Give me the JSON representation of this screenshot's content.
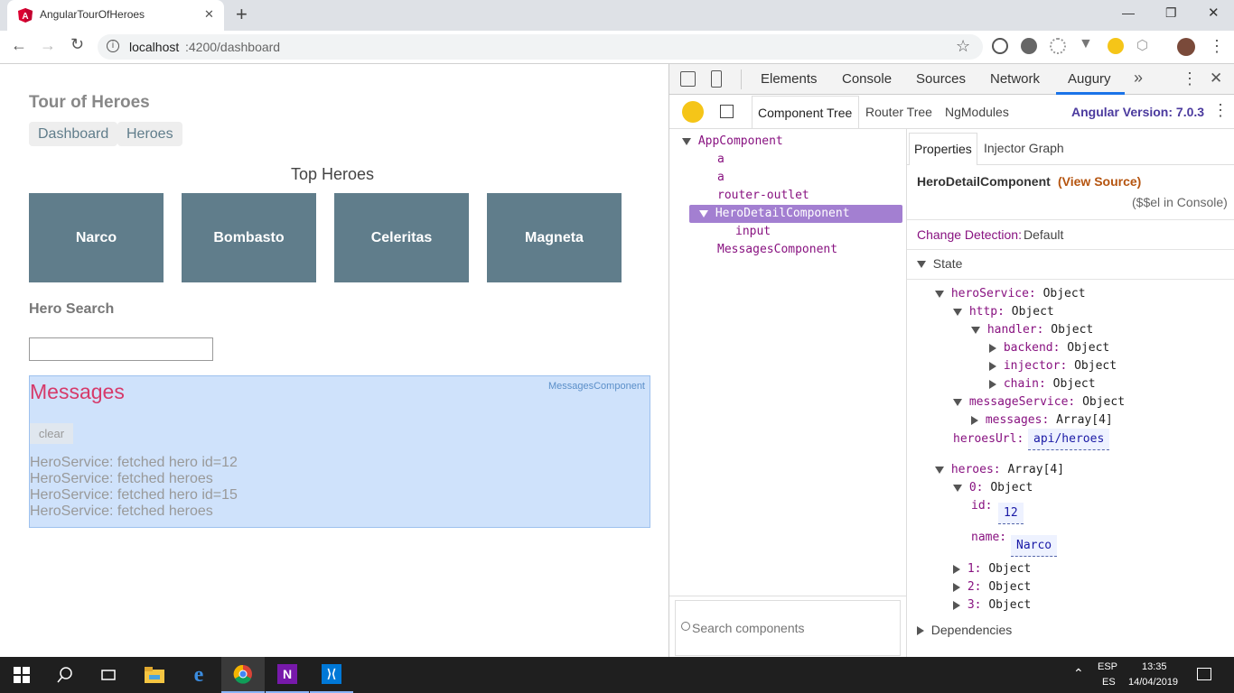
{
  "browser": {
    "tab_title": "AngularTourOfHeroes",
    "new_tab": "+",
    "url_host": "localhost",
    "url_rest": ":4200/dashboard",
    "window_controls": {
      "minimize": "—",
      "maximize": "❐",
      "close": "✕"
    }
  },
  "app": {
    "title": "Tour of Heroes",
    "nav": [
      {
        "label": "Dashboard"
      },
      {
        "label": "Heroes"
      }
    ],
    "top_heroes_title": "Top Heroes",
    "heroes": [
      {
        "name": "Narco"
      },
      {
        "name": "Bombasto"
      },
      {
        "name": "Celeritas"
      },
      {
        "name": "Magneta"
      }
    ],
    "search_title": "Hero Search",
    "search_value": "",
    "messages": {
      "tag": "MessagesComponent",
      "title": "Messages",
      "clear_label": "clear",
      "lines": [
        "HeroService: fetched hero id=12",
        "HeroService: fetched heroes",
        "HeroService: fetched hero id=15",
        "HeroService: fetched heroes"
      ]
    }
  },
  "devtools": {
    "tabs": [
      "Elements",
      "Console",
      "Sources",
      "Network",
      "Augury"
    ],
    "more": "»",
    "augury_tabs": [
      "Component Tree",
      "Router Tree",
      "NgModules"
    ],
    "angular_version": "Angular Version: 7.0.3",
    "tree": [
      {
        "label": "AppComponent"
      },
      {
        "label": "a"
      },
      {
        "label": "a"
      },
      {
        "label": "router-outlet"
      },
      {
        "label": "HeroDetailComponent"
      },
      {
        "label": "input"
      },
      {
        "label": "MessagesComponent"
      }
    ],
    "search_placeholder": "Search components",
    "prop_tabs": [
      "Properties",
      "Injector Graph"
    ],
    "component_name": "HeroDetailComponent",
    "view_source": "(View Source)",
    "el_console": "($$el in Console)",
    "change_detection_label": "Change Detection:",
    "change_detection_value": "Default",
    "state_label": "State",
    "dependencies_label": "Dependencies",
    "state": {
      "heroService": "heroService:",
      "heroService_val": "Object",
      "http": "http:",
      "http_val": "Object",
      "handler": "handler:",
      "handler_val": "Object",
      "backend": "backend:",
      "backend_val": "Object",
      "injector": "injector:",
      "injector_val": "Object",
      "chain": "chain:",
      "chain_val": "Object",
      "messageService": "messageService:",
      "messageService_val": "Object",
      "messages": "messages:",
      "messages_val": "Array[4]",
      "heroesUrl": "heroesUrl:",
      "heroesUrl_val": "api/heroes",
      "heroes": "heroes:",
      "heroes_val": "Array[4]",
      "h0": "0:",
      "h0_val": "Object",
      "id": "id:",
      "id_val": "12",
      "name": "name:",
      "name_val": "Narco",
      "h1": "1:",
      "h1_val": "Object",
      "h2": "2:",
      "h2_val": "Object",
      "h3": "3:",
      "h3_val": "Object"
    }
  },
  "taskbar": {
    "lang_top": "ESP",
    "lang_bottom": "ES",
    "time": "13:35",
    "date": "14/04/2019"
  }
}
